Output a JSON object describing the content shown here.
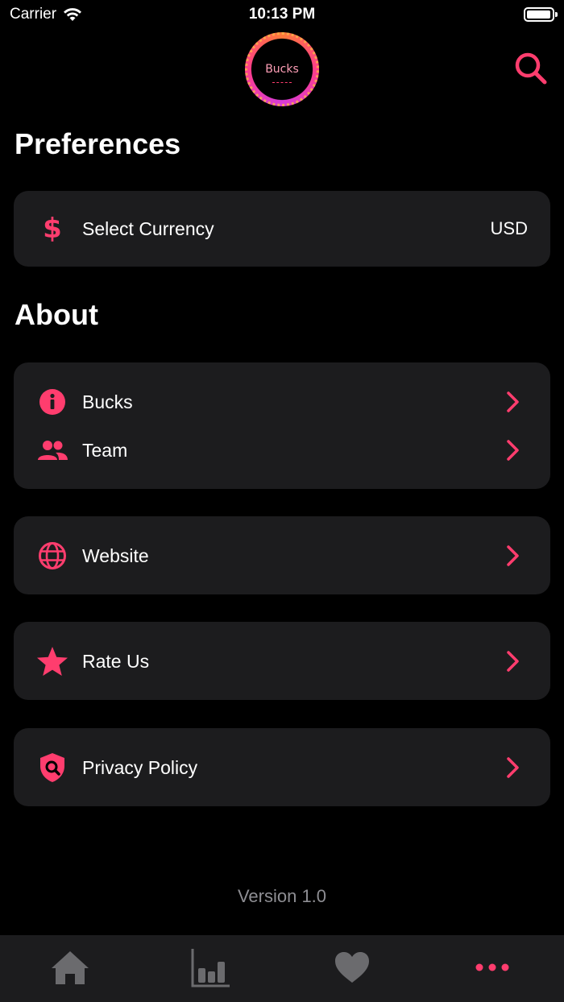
{
  "status_bar": {
    "carrier": "Carrier",
    "time": "10:13 PM"
  },
  "header": {
    "logo_text": "Bucks",
    "search_icon": "search-icon"
  },
  "preferences": {
    "title": "Preferences",
    "currency": {
      "label": "Select Currency",
      "value": "USD",
      "icon": "dollar-icon"
    }
  },
  "about": {
    "title": "About",
    "group1": [
      {
        "label": "Bucks",
        "icon": "info-icon"
      },
      {
        "label": "Team",
        "icon": "team-icon"
      }
    ],
    "website": {
      "label": "Website",
      "icon": "globe-icon"
    },
    "rate": {
      "label": "Rate Us",
      "icon": "star-icon"
    },
    "privacy": {
      "label": "Privacy Policy",
      "icon": "shield-icon"
    }
  },
  "version": "Version 1.0",
  "tabs": [
    {
      "name": "home",
      "icon": "home-icon",
      "active": false
    },
    {
      "name": "stats",
      "icon": "chart-icon",
      "active": false
    },
    {
      "name": "favorites",
      "icon": "heart-icon",
      "active": false
    },
    {
      "name": "more",
      "icon": "more-icon",
      "active": true
    }
  ],
  "colors": {
    "accent": "#ff3d6e",
    "card": "#1c1c1e",
    "background": "#000000",
    "muted": "#8e8e93",
    "tab_inactive": "#6b6b6e"
  }
}
